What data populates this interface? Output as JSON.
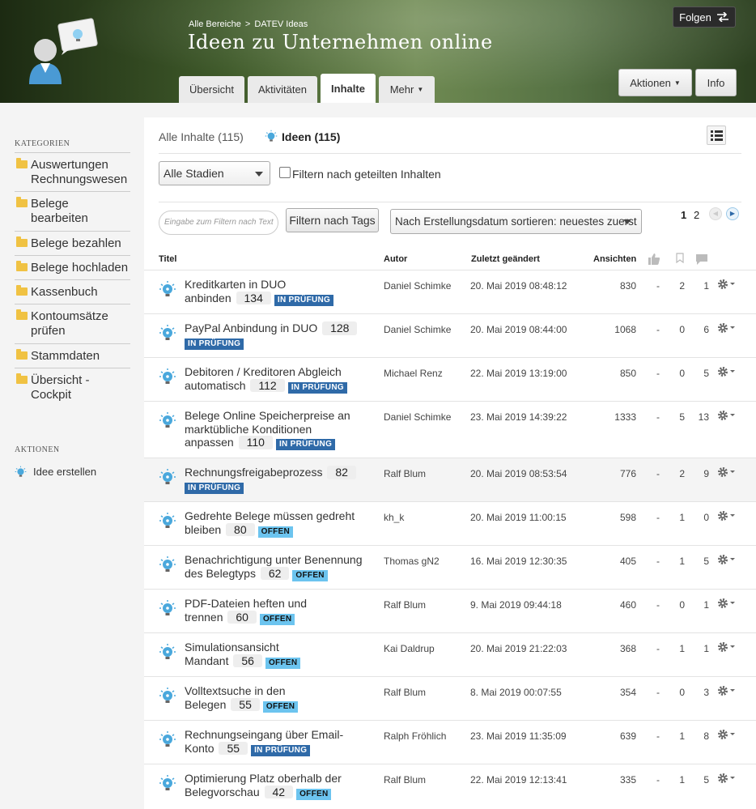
{
  "header": {
    "breadcrumb_root": "Alle Bereiche",
    "breadcrumb_sep": ">",
    "breadcrumb_current": "DATEV Ideas",
    "title": "Ideen zu Unternehmen online",
    "follow": "Folgen",
    "tabs": [
      "Übersicht",
      "Aktivitäten",
      "Inhalte",
      "Mehr"
    ],
    "active_tab": "Inhalte",
    "actions": "Aktionen",
    "info": "Info"
  },
  "sidebar": {
    "categories_heading": "KATEGORIEN",
    "categories": [
      {
        "line1": "Auswertungen",
        "line2": "Rechnungswesen"
      },
      {
        "line1": "Belege",
        "line2": "bearbeiten"
      },
      {
        "line1": "Belege bezahlen",
        "line2": ""
      },
      {
        "line1": "Belege hochladen",
        "line2": ""
      },
      {
        "line1": "Kassenbuch",
        "line2": ""
      },
      {
        "line1": "Kontoumsätze",
        "line2": "prüfen"
      },
      {
        "line1": "Stammdaten",
        "line2": ""
      },
      {
        "line1": "Übersicht -",
        "line2": "Cockpit"
      }
    ],
    "actions_heading": "AKTIONEN",
    "create": "Idee erstellen"
  },
  "content": {
    "all": "Alle Inhalte (115)",
    "ideas": "Ideen (115)",
    "stage_select": "Alle Stadien",
    "shared_filter": "Filtern nach geteilten Inhalten",
    "tag_placeholder": "Eingabe zum Filtern nach Text",
    "tag_button": "Filtern nach Tags",
    "sort": "Nach Erstellungsdatum sortieren: neuestes zuerst",
    "pages": [
      "1",
      "2"
    ],
    "columns": {
      "title": "Titel",
      "author": "Autor",
      "changed": "Zuletzt geändert",
      "views": "Ansichten"
    }
  },
  "rows": [
    {
      "t1": "Kreditkarten in DUO",
      "t2": "anbinden",
      "count": "134",
      "status": "IN PRÜFUNG",
      "author": "Daniel Schimke",
      "date": "20. Mai 2019 08:48:12",
      "views": "830",
      "likes": "-",
      "bookmarks": "2",
      "comments": "1"
    },
    {
      "t1": "PayPal Anbindung in DUO",
      "t2": "",
      "count": "128",
      "status": "IN PRÜFUNG",
      "author": "Daniel Schimke",
      "date": "20. Mai 2019 08:44:00",
      "views": "1068",
      "likes": "-",
      "bookmarks": "0",
      "comments": "6"
    },
    {
      "t1": "Debitoren / Kreditoren Abgleich",
      "t2": "automatisch",
      "count": "112",
      "status": "IN PRÜFUNG",
      "author": "Michael Renz",
      "date": "22. Mai 2019 13:19:00",
      "views": "850",
      "likes": "-",
      "bookmarks": "0",
      "comments": "5"
    },
    {
      "t1": "Belege Online Speicherpreise an",
      "t2": "marktübliche Konditionen",
      "t3": "anpassen",
      "count": "110",
      "status": "IN PRÜFUNG",
      "author": "Daniel Schimke",
      "date": "23. Mai 2019 14:39:22",
      "views": "1333",
      "likes": "-",
      "bookmarks": "5",
      "comments": "13"
    },
    {
      "t1": "Rechnungsfreigabeprozess",
      "t2": "",
      "count": "82",
      "status": "IN PRÜFUNG",
      "author": "Ralf Blum",
      "date": "20. Mai 2019 08:53:54",
      "views": "776",
      "likes": "-",
      "bookmarks": "2",
      "comments": "9"
    },
    {
      "t1": "Gedrehte Belege müssen gedreht",
      "t2": "bleiben",
      "count": "80",
      "status": "OFFEN",
      "author": "kh_k",
      "date": "20. Mai 2019 11:00:15",
      "views": "598",
      "likes": "-",
      "bookmarks": "1",
      "comments": "0"
    },
    {
      "t1": "Benachrichtigung unter Benennung",
      "t2": "des Belegtyps",
      "count": "62",
      "status": "OFFEN",
      "author": "Thomas gN2",
      "date": "16. Mai 2019 12:30:35",
      "views": "405",
      "likes": "-",
      "bookmarks": "1",
      "comments": "5"
    },
    {
      "t1": "PDF-Dateien heften und",
      "t2": "trennen",
      "count": "60",
      "status": "OFFEN",
      "author": "Ralf Blum",
      "date": "9. Mai 2019 09:44:18",
      "views": "460",
      "likes": "-",
      "bookmarks": "0",
      "comments": "1"
    },
    {
      "t1": "Simulationsansicht",
      "t2": "Mandant",
      "count": "56",
      "status": "OFFEN",
      "author": "Kai Daldrup",
      "date": "20. Mai 2019 21:22:03",
      "views": "368",
      "likes": "-",
      "bookmarks": "1",
      "comments": "1"
    },
    {
      "t1": "Volltextsuche in den",
      "t2": "Belegen",
      "count": "55",
      "status": "OFFEN",
      "author": "Ralf Blum",
      "date": "8. Mai 2019 00:07:55",
      "views": "354",
      "likes": "-",
      "bookmarks": "0",
      "comments": "3"
    },
    {
      "t1": "Rechnungseingang über Email-",
      "t2": "Konto",
      "count": "55",
      "status": "IN PRÜFUNG",
      "author": "Ralph Fröhlich",
      "date": "23. Mai 2019 11:35:09",
      "views": "639",
      "likes": "-",
      "bookmarks": "1",
      "comments": "8"
    },
    {
      "t1": "Optimierung Platz oberhalb der",
      "t2": "Belegvorschau",
      "count": "42",
      "status": "OFFEN",
      "author": "Ralf Blum",
      "date": "22. Mai 2019 12:13:41",
      "views": "335",
      "likes": "-",
      "bookmarks": "1",
      "comments": "5"
    }
  ],
  "colors": {
    "in_review": "#2f6aa8",
    "open": "#6cc4ef",
    "header": "#3f5a2a",
    "bulb": "#4aa8dc"
  }
}
